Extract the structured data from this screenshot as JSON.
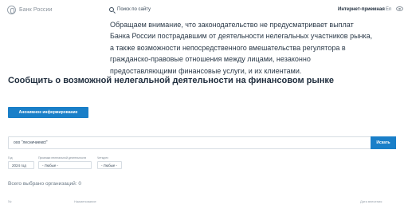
{
  "header": {
    "logo_text": "Банк России",
    "search_label": "Поиск по сайту",
    "reception_label": "Интернет-приемная",
    "lang_label": "En"
  },
  "notice": {
    "text": "Обращаем внимание, что законодательство не предусматривает выплат Банка России пострадавшим от деятельности нелегальных участников рынка, а также возможности непосредственного вмешательства регулятора в гражданско-правовые отношения между лицами, незаконно предоставляющими финансовые услуги, и их клиентами."
  },
  "section": {
    "title": "Сообщить о возможной нелегальной деятельности на финансовом рынке"
  },
  "actions": {
    "anon_button_label": "Анонимное информирование"
  },
  "search": {
    "value": "ооо \"лесничиемсt\"",
    "button_label": "Искать"
  },
  "filters": {
    "year": {
      "label": "Год",
      "value": "2024 год"
    },
    "activity": {
      "label": "Признаки нелегальной деятельности",
      "value": "- Любые -"
    },
    "features": {
      "label": "Четырех",
      "value": "- Любые -"
    }
  },
  "results": {
    "total_label": "Всего выбрано организаций: 0"
  },
  "table": {
    "columns": [
      "№",
      "Наименование",
      "Дата внесения"
    ]
  }
}
